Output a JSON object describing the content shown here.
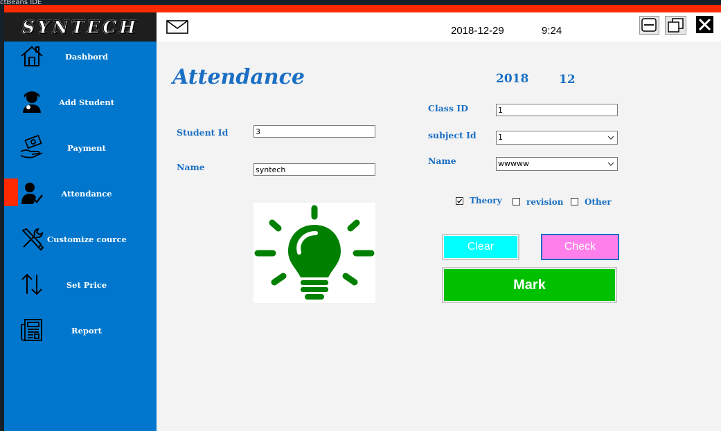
{
  "desktop": {
    "title": "ctBeans IDE"
  },
  "app": {
    "logo": "SYNTECH"
  },
  "header": {
    "date": "2018-12-29",
    "time": "9:24"
  },
  "sidebar": {
    "items": [
      {
        "label": "Dashbord",
        "icon": "home-icon"
      },
      {
        "label": "Add Student",
        "icon": "student-icon"
      },
      {
        "label": "Payment",
        "icon": "payment-icon"
      },
      {
        "label": "Attendance",
        "icon": "attendance-icon",
        "active": true
      },
      {
        "label": "Customize cource",
        "icon": "tools-icon"
      },
      {
        "label": "Set Price",
        "icon": "sort-arrows-icon"
      },
      {
        "label": "Report",
        "icon": "report-icon"
      }
    ]
  },
  "main": {
    "title": "Attendance",
    "year": "2018",
    "month": "12",
    "student_id": {
      "label": "Student Id",
      "value": "3"
    },
    "name": {
      "label": "Name",
      "value": "syntech"
    },
    "class_id": {
      "label": "Class ID",
      "value": "1"
    },
    "subject_id": {
      "label": "subject Id",
      "value": "1"
    },
    "name_select": {
      "label": "Name",
      "value": "wwwww"
    },
    "options": {
      "theory": "Theory",
      "revision": "revision",
      "other": "Other",
      "theory_checked": true
    },
    "buttons": {
      "clear": "Clear",
      "check": "Check",
      "mark": "Mark"
    }
  },
  "colors": {
    "accent_red": "#ff2a00",
    "sidebar_blue": "#0077cc",
    "label_blue": "#1a6fc4",
    "clear_btn": "#00ffff",
    "check_btn": "#ff80ea",
    "mark_btn": "#00c000",
    "bulb_green": "#008000"
  }
}
